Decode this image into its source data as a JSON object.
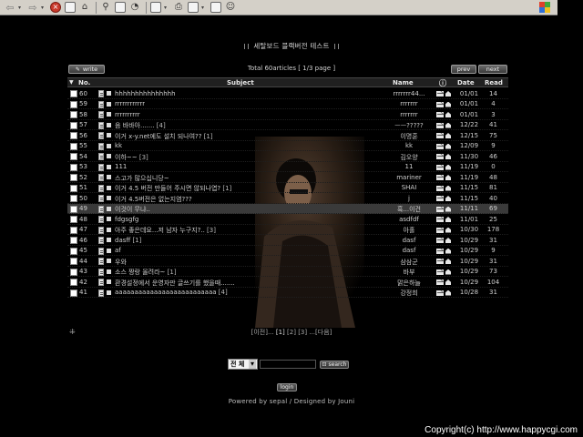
{
  "board": {
    "title": "세탈보드 블랙버전 테스트",
    "write_label": "write",
    "prev_label": "prev",
    "next_label": "next",
    "total_info": "Total 60articles [ 1/3 page ]"
  },
  "columns": {
    "no": "No.",
    "subject": "Subject",
    "name": "Name",
    "date": "Date",
    "read": "Read"
  },
  "rows": [
    {
      "no": "60",
      "subject": "hhhhhhhhhhhhhhh",
      "comments": "",
      "name": "rrrrrrr44...",
      "date": "01/01",
      "read": "14"
    },
    {
      "no": "59",
      "subject": "rrrrrrrrrrrr",
      "comments": "",
      "name": "rrrrrrr",
      "date": "01/01",
      "read": "4"
    },
    {
      "no": "58",
      "subject": "rrrrrrrrrr",
      "comments": "",
      "name": "rrrrrrr",
      "date": "01/01",
      "read": "3"
    },
    {
      "no": "57",
      "subject": "음 바바아.......",
      "comments": "[4]",
      "name": "ㅡㅡ?????",
      "date": "12/22",
      "read": "41"
    },
    {
      "no": "56",
      "subject": "이거 x-y.net에도 설치 되나여??",
      "comments": "[1]",
      "name": "이명훈",
      "date": "12/15",
      "read": "75"
    },
    {
      "no": "55",
      "subject": "kk",
      "comments": "",
      "name": "kk",
      "date": "12/09",
      "read": "9"
    },
    {
      "no": "54",
      "subject": "이하~~",
      "comments": "[3]",
      "name": "김오양",
      "date": "11/30",
      "read": "46"
    },
    {
      "no": "53",
      "subject": "111",
      "comments": "",
      "name": "11",
      "date": "11/19",
      "read": "0"
    },
    {
      "no": "52",
      "subject": "스고가 많으십니당~",
      "comments": "",
      "name": "mariner",
      "date": "11/19",
      "read": "48"
    },
    {
      "no": "51",
      "subject": "이거 4.5 버전 만들어 주시면 않되나엽?",
      "comments": "[1]",
      "name": "SHAI",
      "date": "11/15",
      "read": "81"
    },
    {
      "no": "50",
      "subject": "이거 4.5버전은 없는지염???",
      "comments": "",
      "name": "j",
      "date": "11/15",
      "read": "40"
    },
    {
      "no": "49",
      "subject": "이것이 무냐..",
      "comments": "",
      "name": "흑...이건",
      "date": "11/11",
      "read": "69"
    },
    {
      "no": "48",
      "subject": "fdgsgfg",
      "comments": "",
      "name": "asdfdf",
      "date": "11/01",
      "read": "25"
    },
    {
      "no": "47",
      "subject": "아주 좋은데요...저 남자 누구지?..",
      "comments": "[3]",
      "name": "아홀",
      "date": "10/30",
      "read": "178"
    },
    {
      "no": "46",
      "subject": "dasff",
      "comments": "[1]",
      "name": "dasf",
      "date": "10/29",
      "read": "31"
    },
    {
      "no": "45",
      "subject": "af",
      "comments": "",
      "name": "dasf",
      "date": "10/29",
      "read": "9"
    },
    {
      "no": "44",
      "subject": "우와",
      "comments": "",
      "name": "삼삼군",
      "date": "10/29",
      "read": "31"
    },
    {
      "no": "43",
      "subject": "소스 짱랑 올려라~",
      "comments": "[1]",
      "name": "바부",
      "date": "10/29",
      "read": "73"
    },
    {
      "no": "42",
      "subject": "환경설정에서 운영자만 글쓰기를 했을때.......",
      "comments": "",
      "name": "맑은하늘",
      "date": "10/29",
      "read": "104"
    },
    {
      "no": "41",
      "subject": "aaaaaaaaaaaaaaaaaaaaaaaaaa",
      "comments": "[4]",
      "name": "강정희",
      "date": "10/28",
      "read": "31"
    }
  ],
  "pager": {
    "prev": "[이전]...",
    "current": "[1]",
    "page2": "[2]",
    "page3": "[3]",
    "next": "...[다음]"
  },
  "search": {
    "select_value": "전 체",
    "button_label": "search"
  },
  "login_label": "login",
  "footer_credit": "Powered by sepal / Designed by Jouni",
  "copyright": "Copyright(c) http://www.happycgi.com"
}
